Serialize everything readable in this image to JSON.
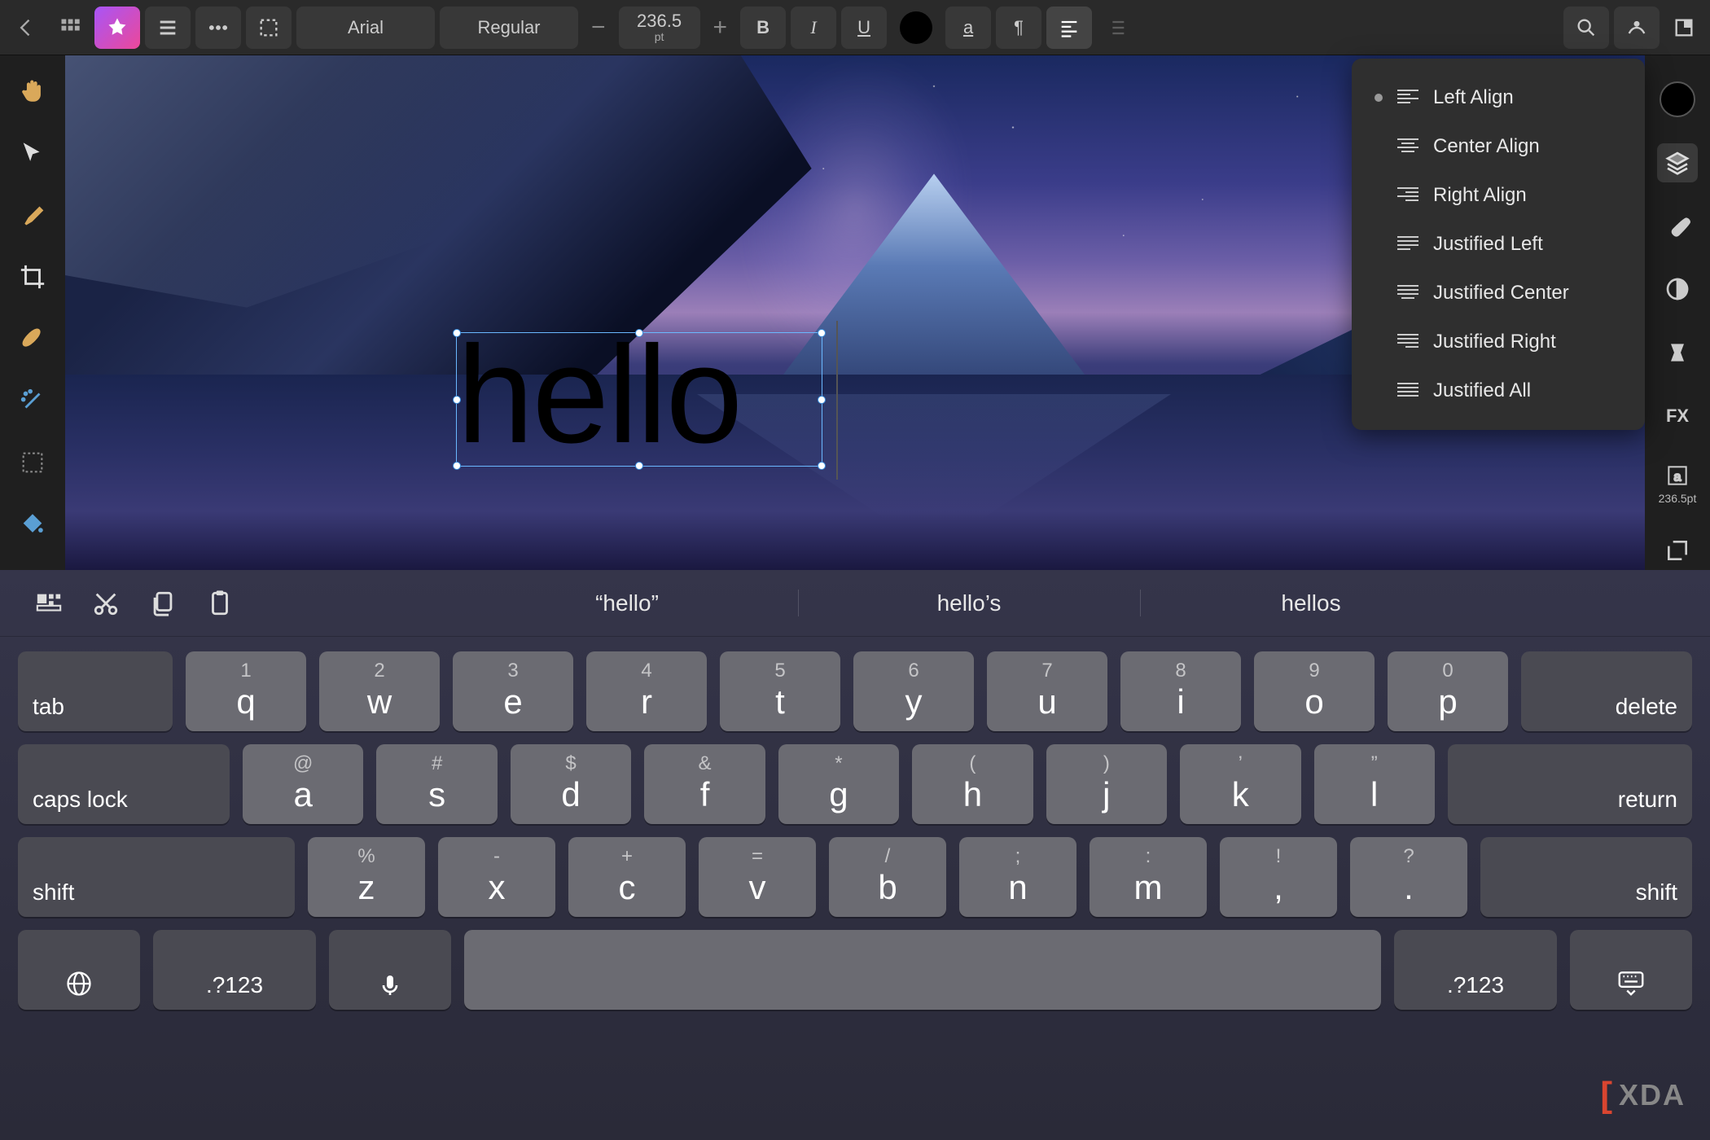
{
  "toolbar": {
    "font_family": "Arial",
    "font_style": "Regular",
    "font_size": "236.5",
    "font_unit": "pt",
    "bold": "B",
    "italic": "I",
    "underline": "U"
  },
  "alignment_menu": {
    "items": [
      {
        "label": "Left Align",
        "selected": true
      },
      {
        "label": "Center Align",
        "selected": false
      },
      {
        "label": "Right Align",
        "selected": false
      },
      {
        "label": "Justified Left",
        "selected": false
      },
      {
        "label": "Justified Center",
        "selected": false
      },
      {
        "label": "Justified Right",
        "selected": false
      },
      {
        "label": "Justified All",
        "selected": false
      }
    ]
  },
  "canvas": {
    "text_content": "hello"
  },
  "right_panel": {
    "char_size": "236.5pt"
  },
  "keyboard": {
    "suggestions": [
      "“hello”",
      "hello’s",
      "hellos"
    ],
    "row1": [
      {
        "main": "q",
        "alt": "1"
      },
      {
        "main": "w",
        "alt": "2"
      },
      {
        "main": "e",
        "alt": "3"
      },
      {
        "main": "r",
        "alt": "4"
      },
      {
        "main": "t",
        "alt": "5"
      },
      {
        "main": "y",
        "alt": "6"
      },
      {
        "main": "u",
        "alt": "7"
      },
      {
        "main": "i",
        "alt": "8"
      },
      {
        "main": "o",
        "alt": "9"
      },
      {
        "main": "p",
        "alt": "0"
      }
    ],
    "row2": [
      {
        "main": "a",
        "alt": "@"
      },
      {
        "main": "s",
        "alt": "#"
      },
      {
        "main": "d",
        "alt": "$"
      },
      {
        "main": "f",
        "alt": "&"
      },
      {
        "main": "g",
        "alt": "*"
      },
      {
        "main": "h",
        "alt": "("
      },
      {
        "main": "j",
        "alt": ")"
      },
      {
        "main": "k",
        "alt": "’"
      },
      {
        "main": "l",
        "alt": "”"
      }
    ],
    "row3": [
      {
        "main": "z",
        "alt": "%"
      },
      {
        "main": "x",
        "alt": "-"
      },
      {
        "main": "c",
        "alt": "+"
      },
      {
        "main": "v",
        "alt": "="
      },
      {
        "main": "b",
        "alt": "/"
      },
      {
        "main": "n",
        "alt": ";"
      },
      {
        "main": "m",
        "alt": ":"
      },
      {
        "main": ",",
        "alt": "!"
      },
      {
        "main": ".",
        "alt": "?"
      }
    ],
    "tab": "tab",
    "delete": "delete",
    "caps": "caps lock",
    "return": "return",
    "shift": "shift",
    "numeric": ".?123"
  },
  "watermark": "XDA"
}
